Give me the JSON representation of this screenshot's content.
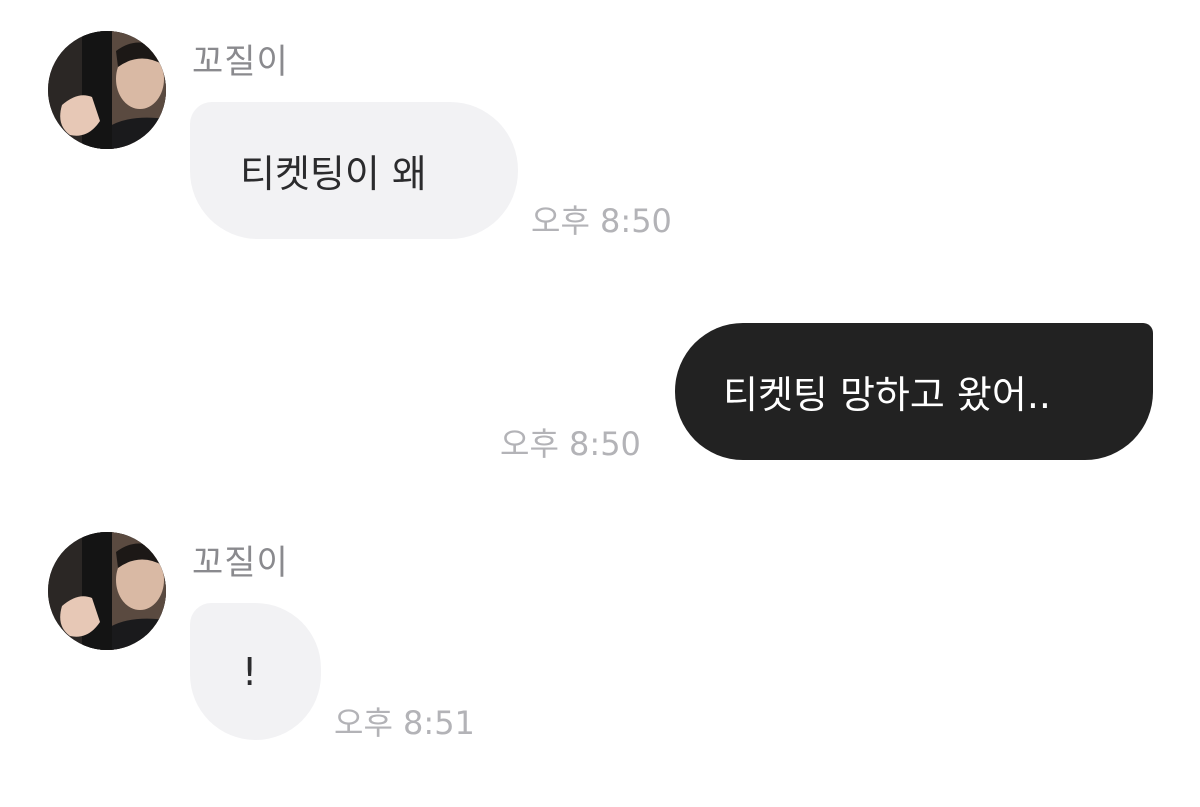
{
  "messages": [
    {
      "sender": "꼬질이",
      "text": "티켓팅이 왜",
      "time": "오후 8:50",
      "direction": "incoming"
    },
    {
      "text": "티켓팅 망하고 왔어..",
      "time": "오후 8:50",
      "direction": "outgoing"
    },
    {
      "sender": "꼬질이",
      "text": "!",
      "time": "오후 8:51",
      "direction": "incoming"
    }
  ],
  "colors": {
    "incoming_bubble": "#f2f2f4",
    "outgoing_bubble": "#222222",
    "timestamp": "#b3b3b7",
    "sender_name": "#8a8a8e"
  }
}
